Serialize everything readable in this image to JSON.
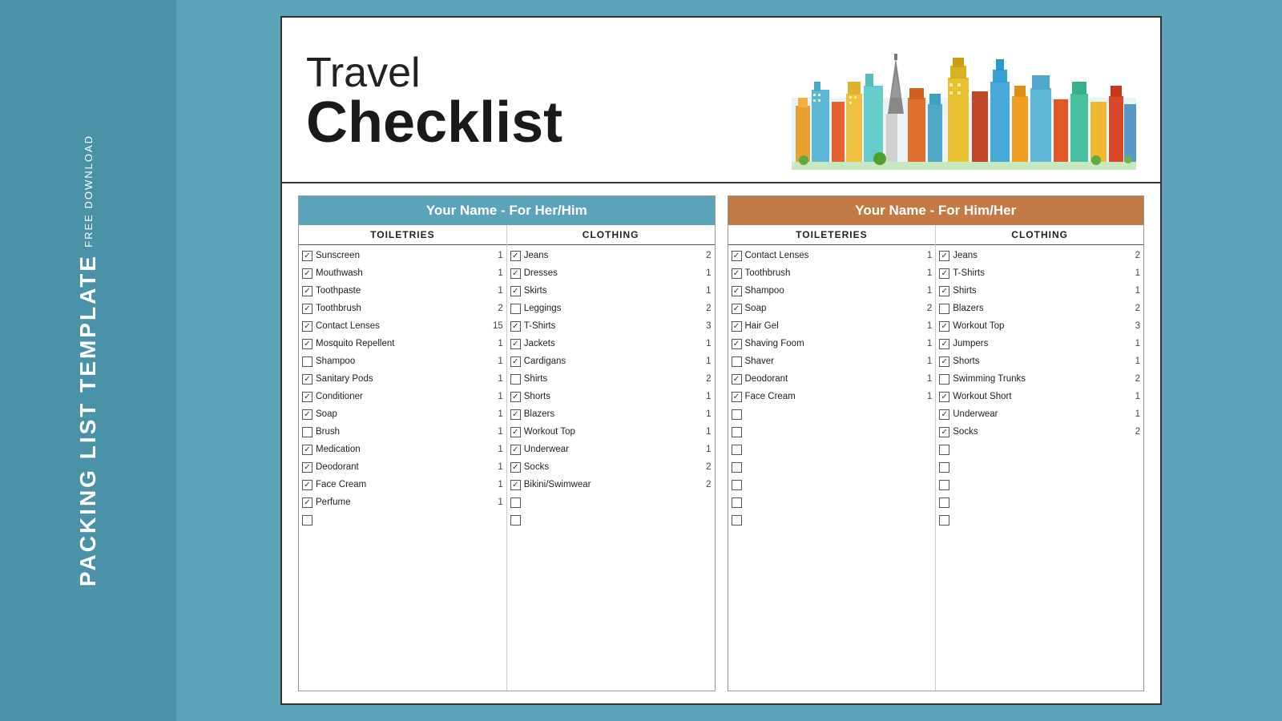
{
  "sidebar": {
    "free_download": "FREE DOWNLOAD",
    "packing_list": "PACKING LIST TEMPLATE"
  },
  "header": {
    "travel": "Travel",
    "checklist": "Checklist"
  },
  "her_section": {
    "title": "Your Name - For Her/Him",
    "toiletries_header": "TOILETRIES",
    "clothing_header": "CLOTHING",
    "toiletries": [
      {
        "checked": true,
        "name": "Sunscreen",
        "qty": "1"
      },
      {
        "checked": true,
        "name": "Mouthwash",
        "qty": "1"
      },
      {
        "checked": true,
        "name": "Toothpaste",
        "qty": "1"
      },
      {
        "checked": true,
        "name": "Toothbrush",
        "qty": "2"
      },
      {
        "checked": true,
        "name": "Contact Lenses",
        "qty": "15"
      },
      {
        "checked": true,
        "name": "Mosquito Repellent",
        "qty": "1"
      },
      {
        "checked": false,
        "name": "Shampoo",
        "qty": "1"
      },
      {
        "checked": true,
        "name": "Sanitary Pods",
        "qty": "1"
      },
      {
        "checked": true,
        "name": "Conditioner",
        "qty": "1"
      },
      {
        "checked": true,
        "name": "Soap",
        "qty": "1"
      },
      {
        "checked": false,
        "name": "Brush",
        "qty": "1"
      },
      {
        "checked": true,
        "name": "Medication",
        "qty": "1"
      },
      {
        "checked": true,
        "name": "Deodorant",
        "qty": "1"
      },
      {
        "checked": true,
        "name": "Face Cream",
        "qty": "1"
      },
      {
        "checked": true,
        "name": "Perfume",
        "qty": "1"
      },
      {
        "checked": false,
        "name": "",
        "qty": ""
      }
    ],
    "clothing": [
      {
        "checked": true,
        "name": "Jeans",
        "qty": "2"
      },
      {
        "checked": true,
        "name": "Dresses",
        "qty": "1"
      },
      {
        "checked": true,
        "name": "Skirts",
        "qty": "1"
      },
      {
        "checked": false,
        "name": "Leggings",
        "qty": "2"
      },
      {
        "checked": true,
        "name": "T-Shirts",
        "qty": "3"
      },
      {
        "checked": true,
        "name": "Jackets",
        "qty": "1"
      },
      {
        "checked": true,
        "name": "Cardigans",
        "qty": "1"
      },
      {
        "checked": false,
        "name": "Shirts",
        "qty": "2"
      },
      {
        "checked": true,
        "name": "Shorts",
        "qty": "1"
      },
      {
        "checked": true,
        "name": "Blazers",
        "qty": "1"
      },
      {
        "checked": true,
        "name": "Workout Top",
        "qty": "1"
      },
      {
        "checked": true,
        "name": "Underwear",
        "qty": "1"
      },
      {
        "checked": true,
        "name": "Socks",
        "qty": "2"
      },
      {
        "checked": true,
        "name": "Bikini/Swimwear",
        "qty": "2"
      },
      {
        "checked": false,
        "name": "",
        "qty": ""
      },
      {
        "checked": false,
        "name": "",
        "qty": ""
      }
    ]
  },
  "him_section": {
    "title": "Your Name - For Him/Her",
    "toiletries_header": "TOILETERIES",
    "clothing_header": "CLOTHING",
    "toiletries": [
      {
        "checked": true,
        "name": "Contact Lenses",
        "qty": "1"
      },
      {
        "checked": true,
        "name": "Toothbrush",
        "qty": "1"
      },
      {
        "checked": true,
        "name": "Shampoo",
        "qty": "1"
      },
      {
        "checked": true,
        "name": "Soap",
        "qty": "2"
      },
      {
        "checked": true,
        "name": "Hair Gel",
        "qty": "1"
      },
      {
        "checked": true,
        "name": "Shaving Foom",
        "qty": "1"
      },
      {
        "checked": false,
        "name": "Shaver",
        "qty": "1"
      },
      {
        "checked": true,
        "name": "Deodorant",
        "qty": "1"
      },
      {
        "checked": true,
        "name": "Face Cream",
        "qty": "1"
      },
      {
        "checked": false,
        "name": "",
        "qty": ""
      },
      {
        "checked": false,
        "name": "",
        "qty": ""
      },
      {
        "checked": false,
        "name": "",
        "qty": ""
      },
      {
        "checked": false,
        "name": "",
        "qty": ""
      },
      {
        "checked": false,
        "name": "",
        "qty": ""
      },
      {
        "checked": false,
        "name": "",
        "qty": ""
      },
      {
        "checked": false,
        "name": "",
        "qty": ""
      }
    ],
    "clothing": [
      {
        "checked": true,
        "name": "Jeans",
        "qty": "2"
      },
      {
        "checked": true,
        "name": "T-Shirts",
        "qty": "1"
      },
      {
        "checked": true,
        "name": "Shirts",
        "qty": "1"
      },
      {
        "checked": false,
        "name": "Blazers",
        "qty": "2"
      },
      {
        "checked": true,
        "name": "Workout Top",
        "qty": "3"
      },
      {
        "checked": true,
        "name": "Jumpers",
        "qty": "1"
      },
      {
        "checked": true,
        "name": "Shorts",
        "qty": "1"
      },
      {
        "checked": false,
        "name": "Swimming Trunks",
        "qty": "2"
      },
      {
        "checked": true,
        "name": "Workout Short",
        "qty": "1"
      },
      {
        "checked": true,
        "name": "Underwear",
        "qty": "1"
      },
      {
        "checked": true,
        "name": "Socks",
        "qty": "2"
      },
      {
        "checked": false,
        "name": "",
        "qty": ""
      },
      {
        "checked": false,
        "name": "",
        "qty": ""
      },
      {
        "checked": false,
        "name": "",
        "qty": ""
      },
      {
        "checked": false,
        "name": "",
        "qty": ""
      },
      {
        "checked": false,
        "name": "",
        "qty": ""
      }
    ]
  }
}
